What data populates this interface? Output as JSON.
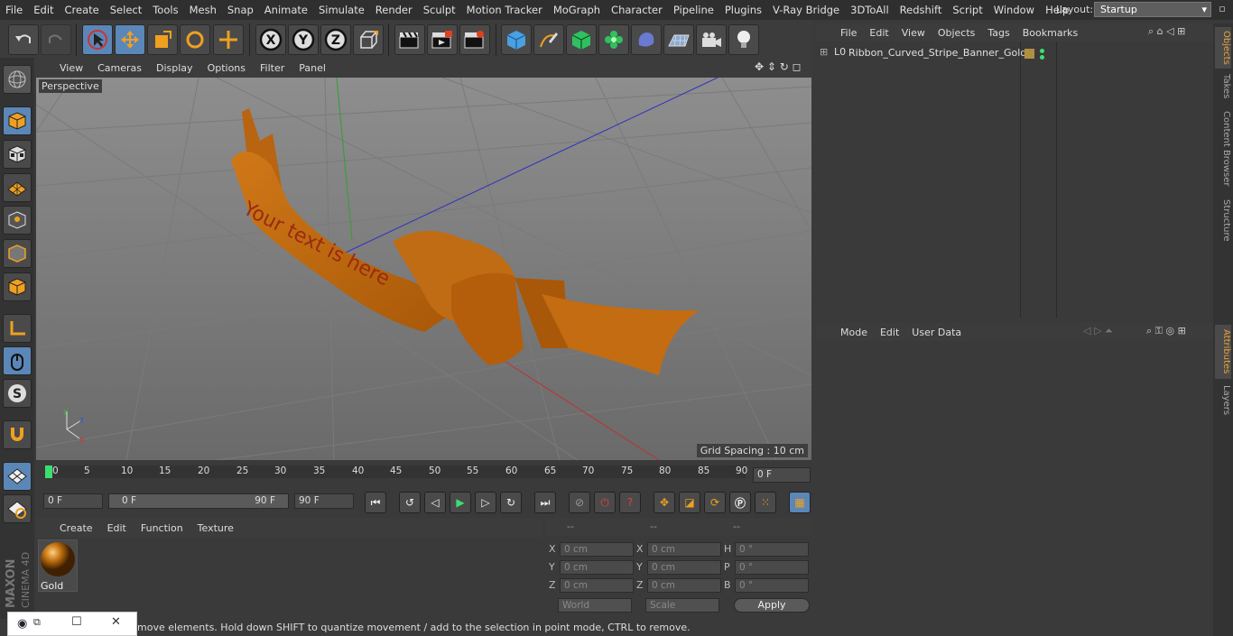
{
  "menu": [
    "File",
    "Edit",
    "Create",
    "Select",
    "Tools",
    "Mesh",
    "Snap",
    "Animate",
    "Simulate",
    "Render",
    "Sculpt",
    "Motion Tracker",
    "MoGraph",
    "Character",
    "Pipeline",
    "Plugins",
    "V-Ray Bridge",
    "3DToAll",
    "Redshift",
    "Script",
    "Window",
    "Help"
  ],
  "layout": {
    "label": "Layout:",
    "value": "Startup"
  },
  "viewport": {
    "menu": [
      "View",
      "Cameras",
      "Display",
      "Options",
      "Filter",
      "Panel"
    ],
    "label": "Perspective",
    "grid_spacing": "Grid Spacing : 10 cm",
    "ribbon_text": "Your text is here"
  },
  "timeline": {
    "ticks": [
      "0",
      "5",
      "10",
      "15",
      "20",
      "25",
      "30",
      "35",
      "40",
      "45",
      "50",
      "55",
      "60",
      "65",
      "70",
      "75",
      "80",
      "85",
      "90"
    ],
    "current_frame": "0 F",
    "start": "0 F",
    "range_start": "0 F",
    "range_end": "90 F",
    "end": "90 F"
  },
  "material": {
    "menu": [
      "Create",
      "Edit",
      "Function",
      "Texture"
    ],
    "name": "Gold"
  },
  "coords": {
    "headers": [
      "--",
      "--",
      "--"
    ],
    "rows": [
      {
        "l1": "X",
        "v1": "0 cm",
        "l2": "X",
        "v2": "0 cm",
        "l3": "H",
        "v3": "0 °"
      },
      {
        "l1": "Y",
        "v1": "0 cm",
        "l2": "Y",
        "v2": "0 cm",
        "l3": "P",
        "v3": "0 °"
      },
      {
        "l1": "Z",
        "v1": "0 cm",
        "l2": "Z",
        "v2": "0 cm",
        "l3": "B",
        "v3": "0 °"
      }
    ],
    "mode": "World",
    "scale": "Scale",
    "apply": "Apply"
  },
  "status": "move elements. Hold down SHIFT to quantize movement / add to the selection in point mode, CTRL to remove.",
  "objects": {
    "menu": [
      "File",
      "Edit",
      "View",
      "Objects",
      "Tags",
      "Bookmarks"
    ],
    "item": "Ribbon_Curved_Stripe_Banner_Gold"
  },
  "attributes": {
    "menu": [
      "Mode",
      "Edit",
      "User Data"
    ]
  },
  "right_tabs": [
    "Objects",
    "Takes",
    "Content Browser",
    "Structure",
    "Attributes",
    "Layers"
  ],
  "brand": {
    "maxon": "MAXON",
    "cinema": "CINEMA 4D"
  },
  "colors": {
    "accent": "#5b87b8",
    "ribbon": "#c86a10",
    "ribbon_text": "#9a2a10"
  }
}
